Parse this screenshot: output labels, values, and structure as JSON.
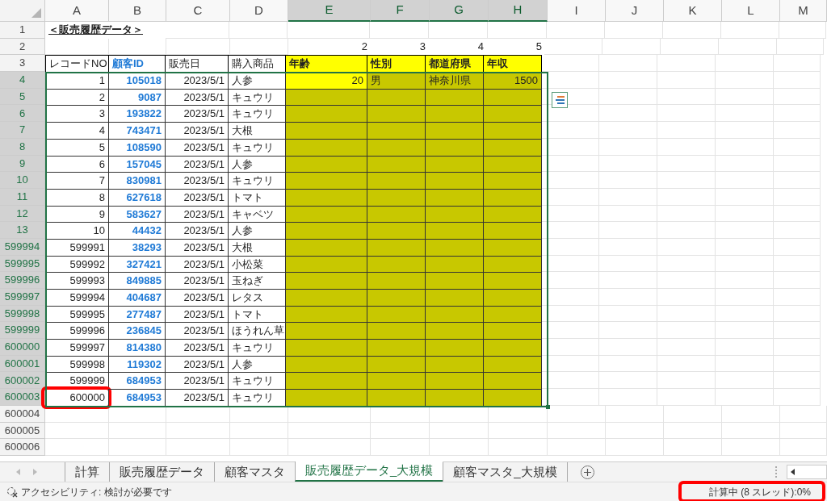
{
  "column_headers": [
    {
      "label": "A",
      "selected": false
    },
    {
      "label": "B",
      "selected": false
    },
    {
      "label": "C",
      "selected": false
    },
    {
      "label": "D",
      "selected": false
    },
    {
      "label": "E",
      "selected": true
    },
    {
      "label": "F",
      "selected": true
    },
    {
      "label": "G",
      "selected": true
    },
    {
      "label": "H",
      "selected": true
    },
    {
      "label": "I",
      "selected": false
    },
    {
      "label": "J",
      "selected": false
    },
    {
      "label": "K",
      "selected": false
    },
    {
      "label": "L",
      "selected": false
    },
    {
      "label": "M",
      "selected": false
    }
  ],
  "rows": [
    {
      "header": "1",
      "selected": false,
      "cells": [
        {
          "kind": "title",
          "text": "＜販売履歴データ＞"
        }
      ]
    },
    {
      "header": "2",
      "selected": false,
      "cells": [
        {
          "kind": "empty"
        },
        {
          "kind": "empty"
        },
        {
          "kind": "empty"
        },
        {
          "kind": "empty"
        },
        {
          "kind": "plain_number",
          "text": "2"
        },
        {
          "kind": "plain_number",
          "text": "3"
        },
        {
          "kind": "plain_number",
          "text": "4"
        },
        {
          "kind": "plain_number",
          "text": "5"
        }
      ]
    },
    {
      "header": "3",
      "selected": false,
      "cells": [
        {
          "kind": "header",
          "text": "レコードNO"
        },
        {
          "kind": "header_id",
          "text": "顧客ID"
        },
        {
          "kind": "header",
          "text": "販売日"
        },
        {
          "kind": "header",
          "text": "購入商品"
        },
        {
          "kind": "header_yellow",
          "text": "年齢"
        },
        {
          "kind": "header_yellow",
          "text": "性別"
        },
        {
          "kind": "header_yellow",
          "text": "都道府県"
        },
        {
          "kind": "header_yellow",
          "text": "年収"
        }
      ]
    },
    {
      "header": "4",
      "selected": true,
      "cells": [
        {
          "kind": "number",
          "text": "1"
        },
        {
          "kind": "id",
          "text": "105018"
        },
        {
          "kind": "number",
          "text": "2023/5/1"
        },
        {
          "kind": "text",
          "text": "人参"
        },
        {
          "kind": "yellow_number",
          "text": "20"
        },
        {
          "kind": "olive_text",
          "text": "男"
        },
        {
          "kind": "olive_text",
          "text": "神奈川県"
        },
        {
          "kind": "olive_number",
          "text": "1500"
        }
      ]
    },
    {
      "header": "5",
      "selected": true,
      "cells": [
        {
          "kind": "number",
          "text": "2"
        },
        {
          "kind": "id",
          "text": "9087"
        },
        {
          "kind": "number",
          "text": "2023/5/1"
        },
        {
          "kind": "text",
          "text": "キュウリ"
        },
        {
          "kind": "olive"
        },
        {
          "kind": "olive"
        },
        {
          "kind": "olive"
        },
        {
          "kind": "olive"
        }
      ]
    },
    {
      "header": "6",
      "selected": true,
      "cells": [
        {
          "kind": "number",
          "text": "3"
        },
        {
          "kind": "id",
          "text": "193822"
        },
        {
          "kind": "number",
          "text": "2023/5/1"
        },
        {
          "kind": "text",
          "text": "キュウリ"
        },
        {
          "kind": "olive"
        },
        {
          "kind": "olive"
        },
        {
          "kind": "olive"
        },
        {
          "kind": "olive"
        }
      ]
    },
    {
      "header": "7",
      "selected": true,
      "cells": [
        {
          "kind": "number",
          "text": "4"
        },
        {
          "kind": "id",
          "text": "743471"
        },
        {
          "kind": "number",
          "text": "2023/5/1"
        },
        {
          "kind": "text",
          "text": "大根"
        },
        {
          "kind": "olive"
        },
        {
          "kind": "olive"
        },
        {
          "kind": "olive"
        },
        {
          "kind": "olive"
        }
      ]
    },
    {
      "header": "8",
      "selected": true,
      "cells": [
        {
          "kind": "number",
          "text": "5"
        },
        {
          "kind": "id",
          "text": "108590"
        },
        {
          "kind": "number",
          "text": "2023/5/1"
        },
        {
          "kind": "text",
          "text": "キュウリ"
        },
        {
          "kind": "olive"
        },
        {
          "kind": "olive"
        },
        {
          "kind": "olive"
        },
        {
          "kind": "olive"
        }
      ]
    },
    {
      "header": "9",
      "selected": true,
      "cells": [
        {
          "kind": "number",
          "text": "6"
        },
        {
          "kind": "id",
          "text": "157045"
        },
        {
          "kind": "number",
          "text": "2023/5/1"
        },
        {
          "kind": "text",
          "text": "人参"
        },
        {
          "kind": "olive"
        },
        {
          "kind": "olive"
        },
        {
          "kind": "olive"
        },
        {
          "kind": "olive"
        }
      ]
    },
    {
      "header": "10",
      "selected": true,
      "cells": [
        {
          "kind": "number",
          "text": "7"
        },
        {
          "kind": "id",
          "text": "830981"
        },
        {
          "kind": "number",
          "text": "2023/5/1"
        },
        {
          "kind": "text",
          "text": "キュウリ"
        },
        {
          "kind": "olive"
        },
        {
          "kind": "olive"
        },
        {
          "kind": "olive"
        },
        {
          "kind": "olive"
        }
      ]
    },
    {
      "header": "11",
      "selected": true,
      "cells": [
        {
          "kind": "number",
          "text": "8"
        },
        {
          "kind": "id",
          "text": "627618"
        },
        {
          "kind": "number",
          "text": "2023/5/1"
        },
        {
          "kind": "text",
          "text": "トマト"
        },
        {
          "kind": "olive"
        },
        {
          "kind": "olive"
        },
        {
          "kind": "olive"
        },
        {
          "kind": "olive"
        }
      ]
    },
    {
      "header": "12",
      "selected": true,
      "cells": [
        {
          "kind": "number",
          "text": "9"
        },
        {
          "kind": "id",
          "text": "583627"
        },
        {
          "kind": "number",
          "text": "2023/5/1"
        },
        {
          "kind": "text",
          "text": "キャベツ"
        },
        {
          "kind": "olive"
        },
        {
          "kind": "olive"
        },
        {
          "kind": "olive"
        },
        {
          "kind": "olive"
        }
      ]
    },
    {
      "header": "13",
      "selected": true,
      "cells": [
        {
          "kind": "number",
          "text": "10"
        },
        {
          "kind": "id",
          "text": "44432"
        },
        {
          "kind": "number",
          "text": "2023/5/1"
        },
        {
          "kind": "text",
          "text": "人参"
        },
        {
          "kind": "olive"
        },
        {
          "kind": "olive"
        },
        {
          "kind": "olive"
        },
        {
          "kind": "olive"
        }
      ]
    },
    {
      "header": "599994",
      "selected": true,
      "cells": [
        {
          "kind": "number",
          "text": "599991"
        },
        {
          "kind": "id",
          "text": "38293"
        },
        {
          "kind": "number",
          "text": "2023/5/1"
        },
        {
          "kind": "text",
          "text": "大根"
        },
        {
          "kind": "olive"
        },
        {
          "kind": "olive"
        },
        {
          "kind": "olive"
        },
        {
          "kind": "olive"
        }
      ]
    },
    {
      "header": "599995",
      "selected": true,
      "cells": [
        {
          "kind": "number",
          "text": "599992"
        },
        {
          "kind": "id",
          "text": "327421"
        },
        {
          "kind": "number",
          "text": "2023/5/1"
        },
        {
          "kind": "text",
          "text": "小松菜"
        },
        {
          "kind": "olive"
        },
        {
          "kind": "olive"
        },
        {
          "kind": "olive"
        },
        {
          "kind": "olive"
        }
      ]
    },
    {
      "header": "599996",
      "selected": true,
      "cells": [
        {
          "kind": "number",
          "text": "599993"
        },
        {
          "kind": "id",
          "text": "849885"
        },
        {
          "kind": "number",
          "text": "2023/5/1"
        },
        {
          "kind": "text",
          "text": "玉ねぎ"
        },
        {
          "kind": "olive"
        },
        {
          "kind": "olive"
        },
        {
          "kind": "olive"
        },
        {
          "kind": "olive"
        }
      ]
    },
    {
      "header": "599997",
      "selected": true,
      "cells": [
        {
          "kind": "number",
          "text": "599994"
        },
        {
          "kind": "id",
          "text": "404687"
        },
        {
          "kind": "number",
          "text": "2023/5/1"
        },
        {
          "kind": "text",
          "text": "レタス"
        },
        {
          "kind": "olive"
        },
        {
          "kind": "olive"
        },
        {
          "kind": "olive"
        },
        {
          "kind": "olive"
        }
      ]
    },
    {
      "header": "599998",
      "selected": true,
      "cells": [
        {
          "kind": "number",
          "text": "599995"
        },
        {
          "kind": "id",
          "text": "277487"
        },
        {
          "kind": "number",
          "text": "2023/5/1"
        },
        {
          "kind": "text",
          "text": "トマト"
        },
        {
          "kind": "olive"
        },
        {
          "kind": "olive"
        },
        {
          "kind": "olive"
        },
        {
          "kind": "olive"
        }
      ]
    },
    {
      "header": "599999",
      "selected": true,
      "cells": [
        {
          "kind": "number",
          "text": "599996"
        },
        {
          "kind": "id",
          "text": "236845"
        },
        {
          "kind": "number",
          "text": "2023/5/1"
        },
        {
          "kind": "text",
          "text": "ほうれん草"
        },
        {
          "kind": "olive"
        },
        {
          "kind": "olive"
        },
        {
          "kind": "olive"
        },
        {
          "kind": "olive"
        }
      ]
    },
    {
      "header": "600000",
      "selected": true,
      "cells": [
        {
          "kind": "number",
          "text": "599997"
        },
        {
          "kind": "id",
          "text": "814380"
        },
        {
          "kind": "number",
          "text": "2023/5/1"
        },
        {
          "kind": "text",
          "text": "キュウリ"
        },
        {
          "kind": "olive"
        },
        {
          "kind": "olive"
        },
        {
          "kind": "olive"
        },
        {
          "kind": "olive"
        }
      ]
    },
    {
      "header": "600001",
      "selected": true,
      "cells": [
        {
          "kind": "number",
          "text": "599998"
        },
        {
          "kind": "id",
          "text": "119302"
        },
        {
          "kind": "number",
          "text": "2023/5/1"
        },
        {
          "kind": "text",
          "text": "人参"
        },
        {
          "kind": "olive"
        },
        {
          "kind": "olive"
        },
        {
          "kind": "olive"
        },
        {
          "kind": "olive"
        }
      ]
    },
    {
      "header": "600002",
      "selected": true,
      "cells": [
        {
          "kind": "number",
          "text": "599999"
        },
        {
          "kind": "id",
          "text": "684953"
        },
        {
          "kind": "number",
          "text": "2023/5/1"
        },
        {
          "kind": "text",
          "text": "キュウリ"
        },
        {
          "kind": "olive"
        },
        {
          "kind": "olive"
        },
        {
          "kind": "olive"
        },
        {
          "kind": "olive"
        }
      ]
    },
    {
      "header": "600003",
      "selected": true,
      "cells": [
        {
          "kind": "number",
          "text": "600000",
          "highlighted": true
        },
        {
          "kind": "id",
          "text": "684953"
        },
        {
          "kind": "number",
          "text": "2023/5/1"
        },
        {
          "kind": "text",
          "text": "キュウリ"
        },
        {
          "kind": "olive"
        },
        {
          "kind": "olive"
        },
        {
          "kind": "olive"
        },
        {
          "kind": "olive"
        }
      ]
    },
    {
      "header": "600004",
      "selected": false,
      "cells": []
    },
    {
      "header": "600005",
      "selected": false,
      "cells": []
    },
    {
      "header": "600006",
      "selected": false,
      "cells": []
    }
  ],
  "sheet_tabs": [
    {
      "label": "計算",
      "selected": false
    },
    {
      "label": "販売履歴データ",
      "selected": false
    },
    {
      "label": "顧客マスタ",
      "selected": false
    },
    {
      "label": "販売履歴データ_大規模",
      "selected": true
    },
    {
      "label": "顧客マスタ_大規模",
      "selected": false
    }
  ],
  "status_bar": {
    "accessibility": "アクセシビリティ: 検討が必要です",
    "calculation": {
      "text": "計算中 (8 スレッド):0%",
      "highlighted": true
    }
  }
}
